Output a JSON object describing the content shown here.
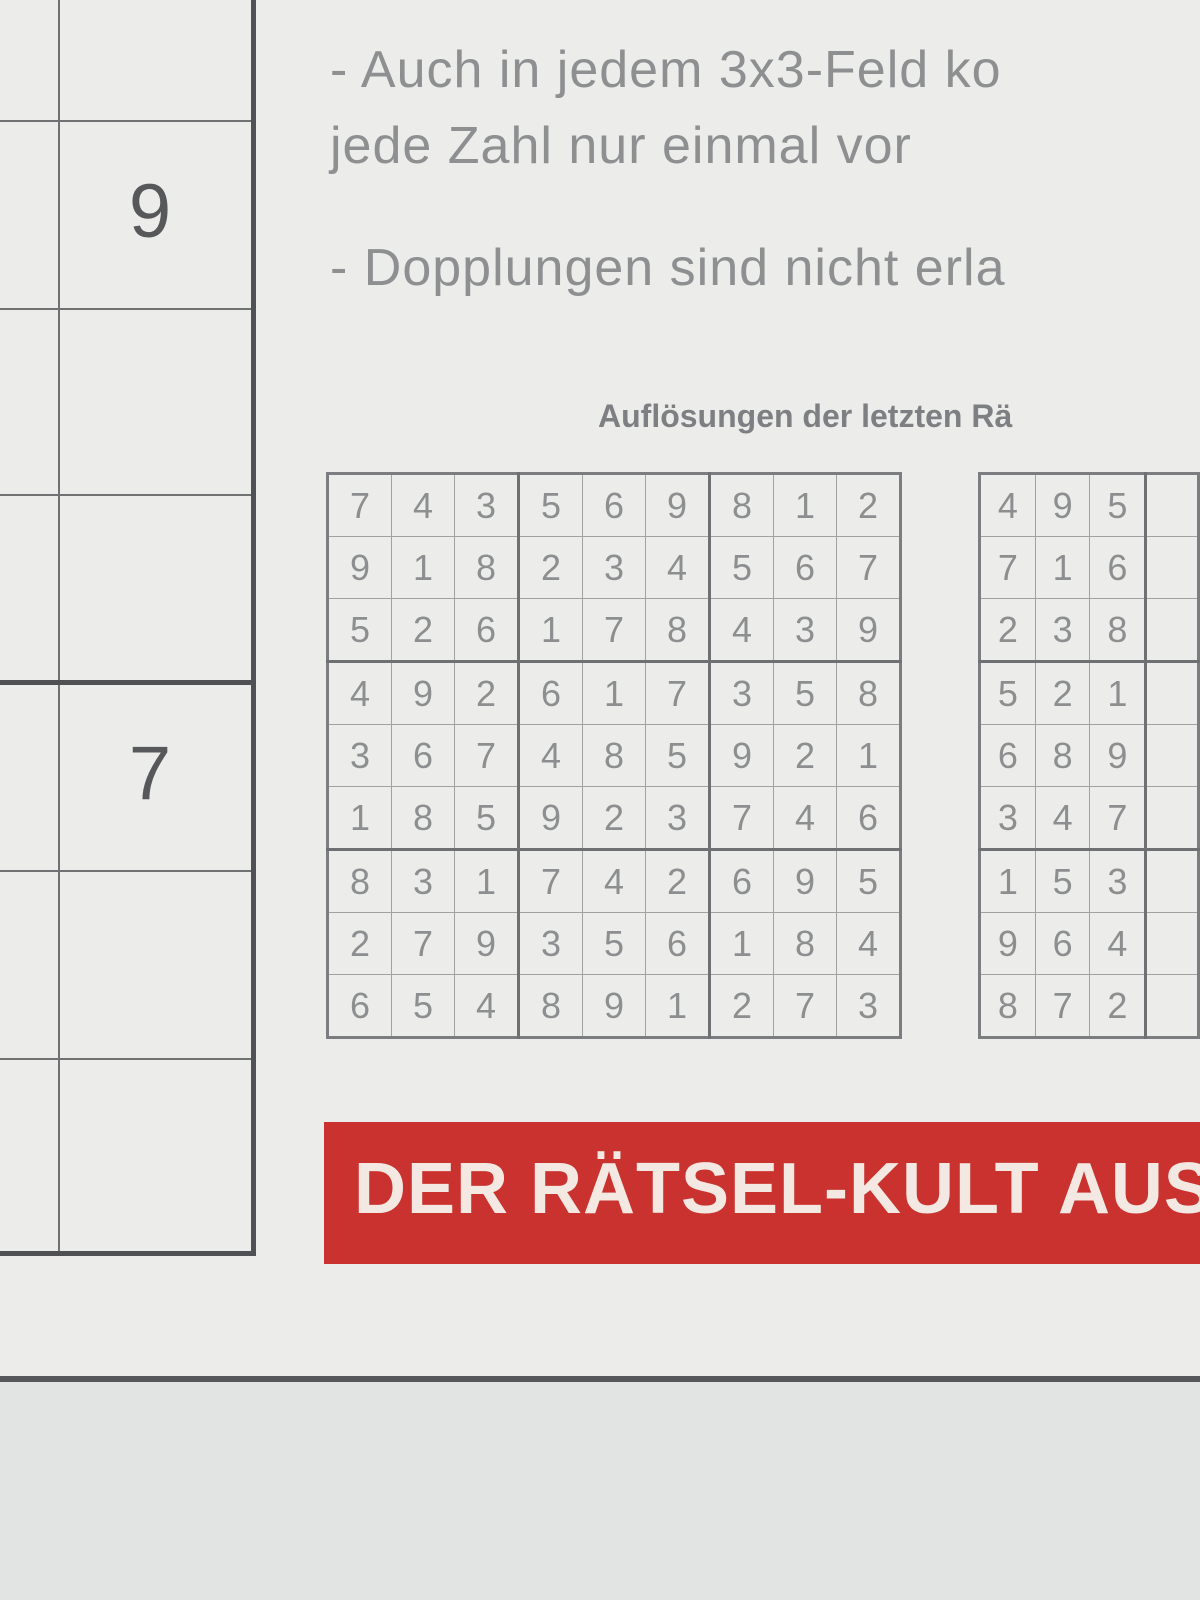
{
  "instructions": {
    "line1": "- Auch in jedem 3x3-Feld ko",
    "line2": "jede Zahl nur einmal vor",
    "line3": "- Dopplungen sind nicht erla"
  },
  "left_puzzle": {
    "numbers": [
      "9",
      "7"
    ]
  },
  "solutions_heading": "Auflösungen der letzten Rä",
  "solution_grid_1": [
    [
      "7",
      "4",
      "3",
      "5",
      "6",
      "9",
      "8",
      "1",
      "2"
    ],
    [
      "9",
      "1",
      "8",
      "2",
      "3",
      "4",
      "5",
      "6",
      "7"
    ],
    [
      "5",
      "2",
      "6",
      "1",
      "7",
      "8",
      "4",
      "3",
      "9"
    ],
    [
      "4",
      "9",
      "2",
      "6",
      "1",
      "7",
      "3",
      "5",
      "8"
    ],
    [
      "3",
      "6",
      "7",
      "4",
      "8",
      "5",
      "9",
      "2",
      "1"
    ],
    [
      "1",
      "8",
      "5",
      "9",
      "2",
      "3",
      "7",
      "4",
      "6"
    ],
    [
      "8",
      "3",
      "1",
      "7",
      "4",
      "2",
      "6",
      "9",
      "5"
    ],
    [
      "2",
      "7",
      "9",
      "3",
      "5",
      "6",
      "1",
      "8",
      "4"
    ],
    [
      "6",
      "5",
      "4",
      "8",
      "9",
      "1",
      "2",
      "7",
      "3"
    ]
  ],
  "solution_grid_2_partial": [
    [
      "4",
      "9",
      "5"
    ],
    [
      "7",
      "1",
      "6"
    ],
    [
      "2",
      "3",
      "8"
    ],
    [
      "5",
      "2",
      "1"
    ],
    [
      "6",
      "8",
      "9"
    ],
    [
      "3",
      "4",
      "7"
    ],
    [
      "1",
      "5",
      "3"
    ],
    [
      "9",
      "6",
      "4"
    ],
    [
      "8",
      "7",
      "2"
    ]
  ],
  "banner": {
    "text": "DER RÄTSEL-KULT AUS",
    "color": "#c9322e"
  }
}
